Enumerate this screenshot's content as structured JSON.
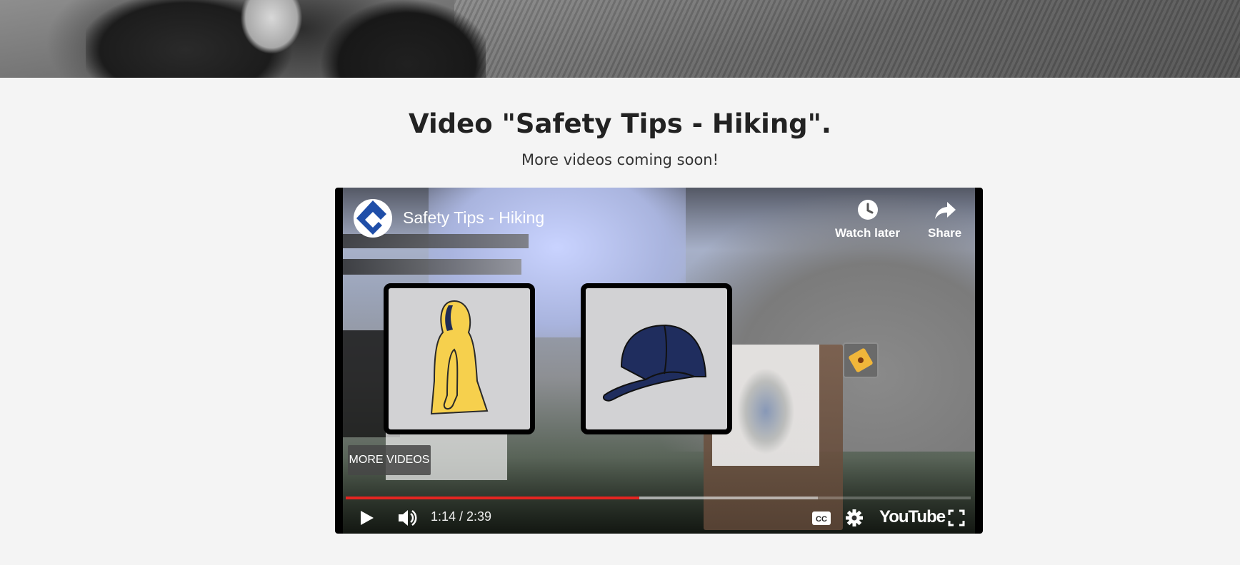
{
  "page": {
    "title": "Video \"Safety Tips - Hiking\".",
    "subtitle": "More videos coming soon!"
  },
  "player": {
    "video_title": "Safety Tips - Hiking",
    "watch_later_label": "Watch later",
    "share_label": "Share",
    "more_videos_label": "MORE VIDEOS",
    "time_display": "1:14 / 2:39",
    "brand_label": "YouTube",
    "played_fraction": 0.47,
    "buffered_fraction": 0.755,
    "progress_color": "#e52521"
  },
  "icons": {
    "channel_logo": "channel-logo-icon",
    "watch_later": "clock-icon",
    "share": "share-arrow-icon",
    "play": "play-icon",
    "volume": "volume-icon",
    "captions": "cc-icon",
    "settings": "gear-icon",
    "fullscreen": "fullscreen-icon"
  }
}
